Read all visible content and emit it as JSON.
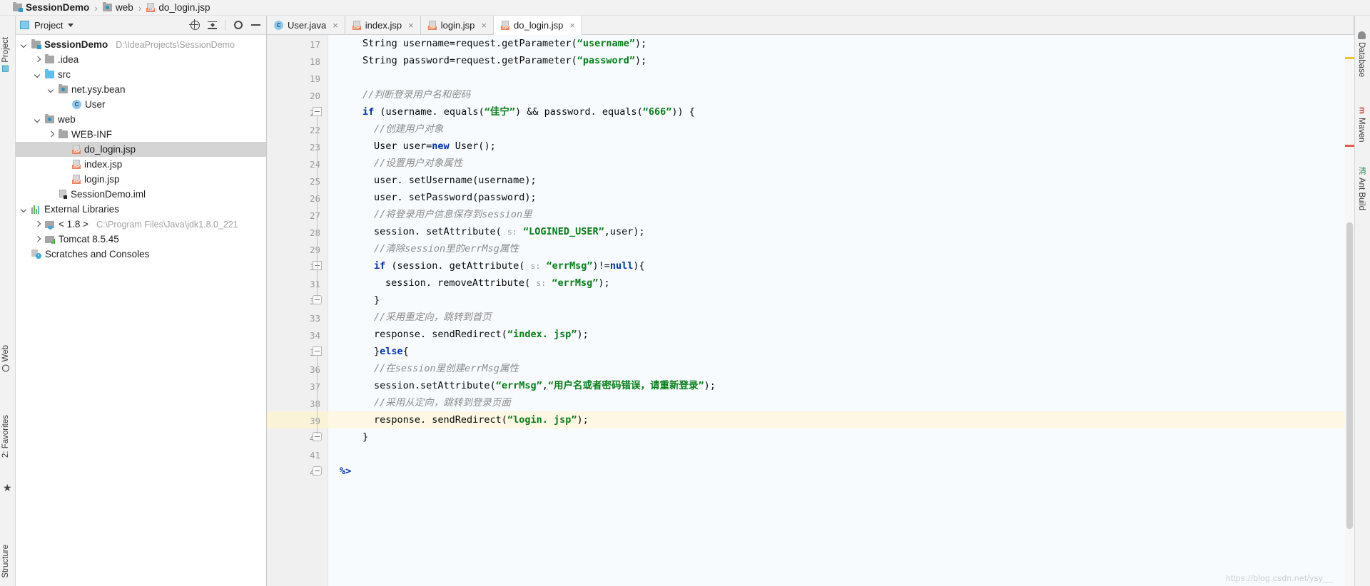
{
  "breadcrumb": {
    "items": [
      {
        "label": "SessionDemo",
        "icon": "project-folder-icon",
        "bold": true
      },
      {
        "label": "web",
        "icon": "web-folder-icon",
        "bold": false
      },
      {
        "label": "do_login.jsp",
        "icon": "jsp-file-icon",
        "bold": false
      }
    ],
    "separator": "›"
  },
  "left_strip": {
    "project_tab": "Project",
    "web_tab": "Web",
    "favorites_tab": "2: Favorites",
    "structure_tab": "Structure",
    "star": "★"
  },
  "right_strip": {
    "database_tab": "Database",
    "maven_tab": "Maven",
    "ant_tab": "Ant Build",
    "maven_icon_text": "m",
    "ant_icon_text": "清"
  },
  "project_panel": {
    "title": "Project",
    "toolbar_icons": [
      "locate-icon",
      "collapse-all-icon",
      "settings-gear-icon",
      "hide-icon"
    ],
    "tree": [
      {
        "indent": 0,
        "arrow": "down",
        "icon": "project-folder-icon",
        "label": "SessionDemo",
        "bold": true,
        "path": "D:\\IdeaProjects\\SessionDemo",
        "selected": false
      },
      {
        "indent": 1,
        "arrow": "right",
        "icon": "folder-icon",
        "label": ".idea",
        "bold": false,
        "path": "",
        "selected": false
      },
      {
        "indent": 1,
        "arrow": "down",
        "icon": "source-folder-icon",
        "label": "src",
        "bold": false,
        "path": "",
        "selected": false
      },
      {
        "indent": 2,
        "arrow": "down",
        "icon": "package-icon",
        "label": "net.ysy.bean",
        "bold": false,
        "path": "",
        "selected": false
      },
      {
        "indent": 3,
        "arrow": "none",
        "icon": "java-class-icon",
        "label": "User",
        "bold": false,
        "path": "",
        "selected": false
      },
      {
        "indent": 1,
        "arrow": "down",
        "icon": "web-folder-icon",
        "label": "web",
        "bold": false,
        "path": "",
        "selected": false
      },
      {
        "indent": 2,
        "arrow": "right",
        "icon": "folder-icon",
        "label": "WEB-INF",
        "bold": false,
        "path": "",
        "selected": false
      },
      {
        "indent": 3,
        "arrow": "none",
        "icon": "jsp-file-icon",
        "label": "do_login.jsp",
        "bold": false,
        "path": "",
        "selected": true
      },
      {
        "indent": 3,
        "arrow": "none",
        "icon": "jsp-file-icon",
        "label": "index.jsp",
        "bold": false,
        "path": "",
        "selected": false
      },
      {
        "indent": 3,
        "arrow": "none",
        "icon": "jsp-file-icon",
        "label": "login.jsp",
        "bold": false,
        "path": "",
        "selected": false
      },
      {
        "indent": 2,
        "arrow": "none",
        "icon": "iml-file-icon",
        "label": "SessionDemo.iml",
        "bold": false,
        "path": "",
        "selected": false
      },
      {
        "indent": 0,
        "arrow": "down",
        "icon": "external-libraries-icon",
        "label": "External Libraries",
        "bold": false,
        "path": "",
        "selected": false
      },
      {
        "indent": 1,
        "arrow": "right",
        "icon": "jdk-icon",
        "label": "< 1.8 >",
        "bold": false,
        "path": "C:\\Program Files\\Java\\jdk1.8.0_221",
        "selected": false
      },
      {
        "indent": 1,
        "arrow": "right",
        "icon": "tomcat-icon",
        "label": "Tomcat 8.5.45",
        "bold": false,
        "path": "",
        "selected": false
      },
      {
        "indent": 0,
        "arrow": "none",
        "icon": "scratches-icon",
        "label": "Scratches and Consoles",
        "bold": false,
        "path": "",
        "selected": false
      }
    ]
  },
  "editor": {
    "tabs": [
      {
        "label": "User.java",
        "icon": "java-class-icon",
        "active": false,
        "close": "×"
      },
      {
        "label": "index.jsp",
        "icon": "jsp-file-icon",
        "active": false,
        "close": "×"
      },
      {
        "label": "login.jsp",
        "icon": "jsp-file-icon",
        "active": false,
        "close": "×"
      },
      {
        "label": "do_login.jsp",
        "icon": "jsp-file-icon",
        "active": true,
        "close": "×"
      }
    ],
    "highlighted_line": 39,
    "lines": [
      {
        "n": 17,
        "indent": 4,
        "fold": "none",
        "tokens": [
          {
            "t": "plain",
            "v": "String username=request."
          },
          {
            "t": "plain",
            "v": "getParameter("
          },
          {
            "t": "str",
            "v": "“username”"
          },
          {
            "t": "plain",
            "v": ");"
          }
        ]
      },
      {
        "n": 18,
        "indent": 4,
        "fold": "none",
        "tokens": [
          {
            "t": "plain",
            "v": "String password=request."
          },
          {
            "t": "plain",
            "v": "getParameter("
          },
          {
            "t": "str",
            "v": "“password”"
          },
          {
            "t": "plain",
            "v": ");"
          }
        ]
      },
      {
        "n": 19,
        "indent": 4,
        "fold": "none",
        "tokens": []
      },
      {
        "n": 20,
        "indent": 4,
        "fold": "none",
        "tokens": [
          {
            "t": "cmt",
            "v": "//判断登录用户名和密码"
          }
        ]
      },
      {
        "n": 21,
        "indent": 4,
        "fold": "open",
        "tokens": [
          {
            "t": "kw",
            "v": "if"
          },
          {
            "t": "plain",
            "v": " (username. equals("
          },
          {
            "t": "str",
            "v": "“佳宁”"
          },
          {
            "t": "plain",
            "v": ") && password. equals("
          },
          {
            "t": "str",
            "v": "“666”"
          },
          {
            "t": "plain",
            "v": ")) {"
          }
        ]
      },
      {
        "n": 22,
        "indent": 6,
        "fold": "none",
        "tokens": [
          {
            "t": "cmt",
            "v": "//创建用户对象"
          }
        ]
      },
      {
        "n": 23,
        "indent": 6,
        "fold": "none",
        "tokens": [
          {
            "t": "plain",
            "v": "User user="
          },
          {
            "t": "kw",
            "v": "new"
          },
          {
            "t": "plain",
            "v": " User();"
          }
        ]
      },
      {
        "n": 24,
        "indent": 6,
        "fold": "none",
        "tokens": [
          {
            "t": "cmt",
            "v": "//设置用户对象属性"
          }
        ]
      },
      {
        "n": 25,
        "indent": 6,
        "fold": "none",
        "tokens": [
          {
            "t": "plain",
            "v": "user. setUsername(username);"
          }
        ]
      },
      {
        "n": 26,
        "indent": 6,
        "fold": "none",
        "tokens": [
          {
            "t": "plain",
            "v": "user. setPassword(password);"
          }
        ]
      },
      {
        "n": 27,
        "indent": 6,
        "fold": "none",
        "tokens": [
          {
            "t": "cmt",
            "v": "//将登录用户信息保存到session里"
          }
        ]
      },
      {
        "n": 28,
        "indent": 6,
        "fold": "none",
        "tokens": [
          {
            "t": "plain",
            "v": "session. setAttribute( "
          },
          {
            "t": "hint",
            "v": "s:"
          },
          {
            "t": "plain",
            "v": " "
          },
          {
            "t": "str",
            "v": "“LOGINED_USER”"
          },
          {
            "t": "plain",
            "v": ",user);"
          }
        ]
      },
      {
        "n": 29,
        "indent": 6,
        "fold": "none",
        "tokens": [
          {
            "t": "cmt",
            "v": "//清除session里的errMsg属性"
          }
        ]
      },
      {
        "n": 30,
        "indent": 6,
        "fold": "open",
        "tokens": [
          {
            "t": "kw",
            "v": "if"
          },
          {
            "t": "plain",
            "v": " (session. getAttribute( "
          },
          {
            "t": "hint",
            "v": "s:"
          },
          {
            "t": "plain",
            "v": " "
          },
          {
            "t": "str",
            "v": "“errMsg”"
          },
          {
            "t": "plain",
            "v": ")!="
          },
          {
            "t": "kw",
            "v": "null"
          },
          {
            "t": "plain",
            "v": "){"
          }
        ]
      },
      {
        "n": 31,
        "indent": 8,
        "fold": "none",
        "tokens": [
          {
            "t": "plain",
            "v": "session. removeAttribute( "
          },
          {
            "t": "hint",
            "v": "s:"
          },
          {
            "t": "plain",
            "v": " "
          },
          {
            "t": "str",
            "v": "“errMsg”"
          },
          {
            "t": "plain",
            "v": ");"
          }
        ]
      },
      {
        "n": 32,
        "indent": 6,
        "fold": "close",
        "tokens": [
          {
            "t": "plain",
            "v": "}"
          }
        ]
      },
      {
        "n": 33,
        "indent": 6,
        "fold": "none",
        "tokens": [
          {
            "t": "cmt",
            "v": "//采用重定向，跳转到首页"
          }
        ]
      },
      {
        "n": 34,
        "indent": 6,
        "fold": "none",
        "tokens": [
          {
            "t": "plain",
            "v": "response. sendRedirect("
          },
          {
            "t": "str",
            "v": "“index. jsp”"
          },
          {
            "t": "plain",
            "v": ");"
          }
        ]
      },
      {
        "n": 35,
        "indent": 6,
        "fold": "open",
        "tokens": [
          {
            "t": "plain",
            "v": "}"
          },
          {
            "t": "kw",
            "v": "else"
          },
          {
            "t": "plain",
            "v": "{"
          }
        ]
      },
      {
        "n": 36,
        "indent": 6,
        "fold": "none",
        "tokens": [
          {
            "t": "cmt",
            "v": "//在session里创建errMsg属性"
          }
        ]
      },
      {
        "n": 37,
        "indent": 6,
        "fold": "none",
        "tokens": [
          {
            "t": "plain",
            "v": "session.setAttribute("
          },
          {
            "t": "str",
            "v": "“errMsg”"
          },
          {
            "t": "plain",
            "v": ","
          },
          {
            "t": "str",
            "v": "“用户名或者密码错误，请重新登录”"
          },
          {
            "t": "plain",
            "v": ");"
          }
        ]
      },
      {
        "n": 38,
        "indent": 6,
        "fold": "none",
        "tokens": [
          {
            "t": "cmt",
            "v": "//采用从定向，跳转到登录页面"
          }
        ]
      },
      {
        "n": 39,
        "indent": 6,
        "fold": "none",
        "tokens": [
          {
            "t": "plain",
            "v": "response. sendRedirect("
          },
          {
            "t": "str",
            "v": "“login. jsp”"
          },
          {
            "t": "plain",
            "v": ");"
          }
        ]
      },
      {
        "n": 40,
        "indent": 4,
        "fold": "close",
        "tokens": [
          {
            "t": "plain",
            "v": "}"
          }
        ]
      },
      {
        "n": 41,
        "indent": 4,
        "fold": "none",
        "tokens": []
      },
      {
        "n": 42,
        "indent": 0,
        "fold": "close",
        "tokens": [
          {
            "t": "kw",
            "v": "%>"
          }
        ]
      }
    ]
  },
  "watermark": "https://blog.csdn.net/ysy__",
  "colors": {
    "keyword": "#0033b3",
    "string": "#067d17",
    "comment": "#8c8c8c",
    "selection": "#d4d4d4",
    "highlight_line": "#fdf7e3",
    "code_bg": "#f7fbfe",
    "panel_bg": "#f2f2f2",
    "jsp_badge": "#e8845c"
  }
}
